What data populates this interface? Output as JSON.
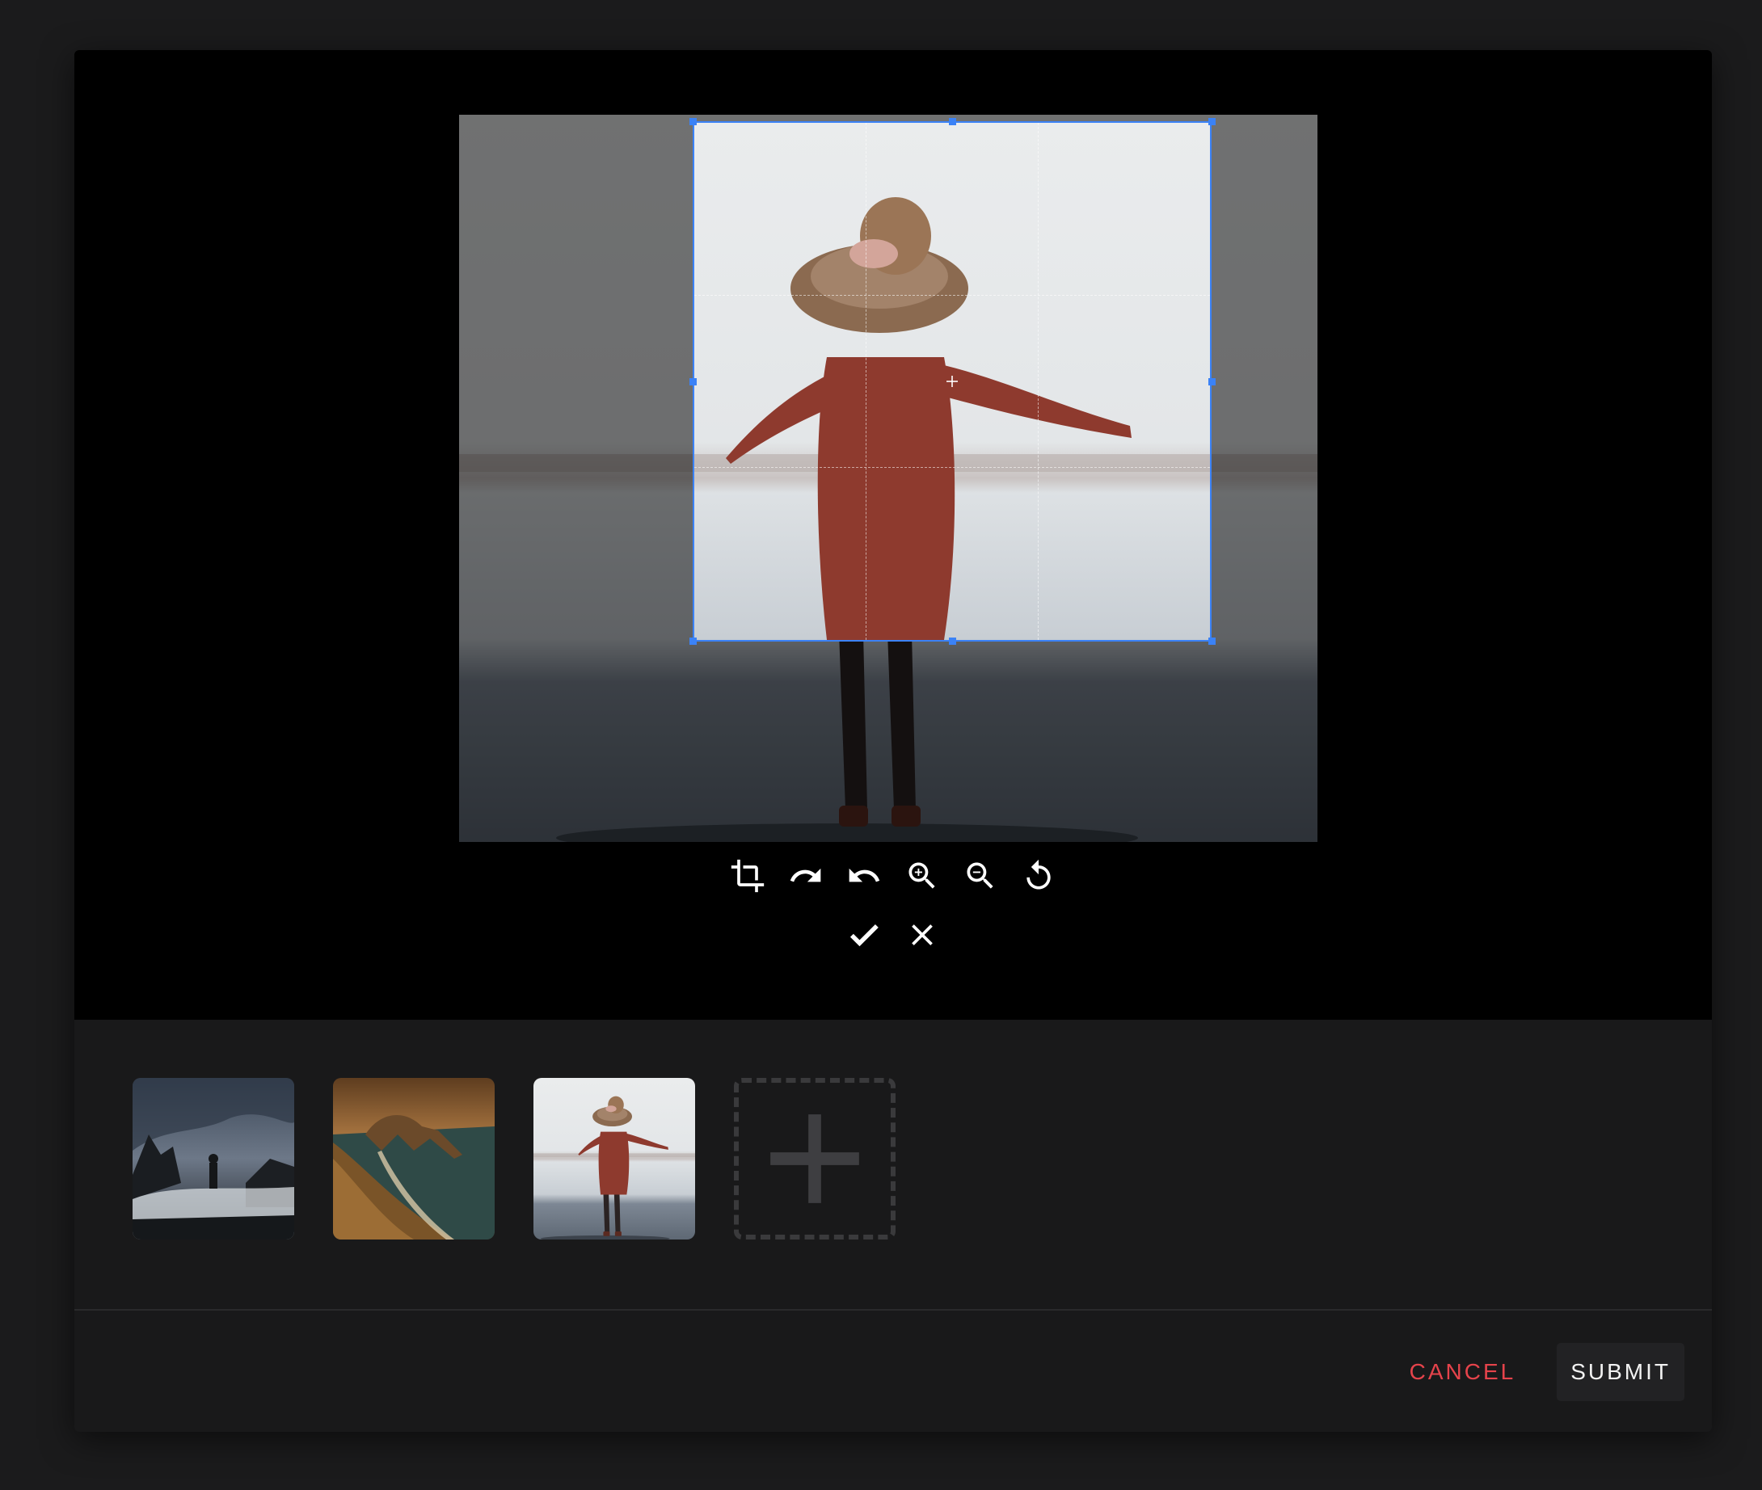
{
  "editor": {
    "toolbar": [
      {
        "name": "crop-icon"
      },
      {
        "name": "rotate-right-icon"
      },
      {
        "name": "rotate-left-icon"
      },
      {
        "name": "zoom-in-icon"
      },
      {
        "name": "zoom-out-icon"
      },
      {
        "name": "reset-icon"
      }
    ],
    "confirm_actions": [
      {
        "name": "check-icon"
      },
      {
        "name": "close-icon"
      }
    ]
  },
  "gallery": {
    "thumbnails": [
      {
        "name": "rocky-coast-photo"
      },
      {
        "name": "sea-arch-photo"
      },
      {
        "name": "woman-red-jacket-photo"
      }
    ],
    "add_icon": "plus-icon"
  },
  "footer": {
    "cancel_label": "CANCEL",
    "submit_label": "SUBMIT"
  },
  "colors": {
    "accent": "#3b82f6",
    "cancel": "#e5434b",
    "background": "#19191a"
  }
}
